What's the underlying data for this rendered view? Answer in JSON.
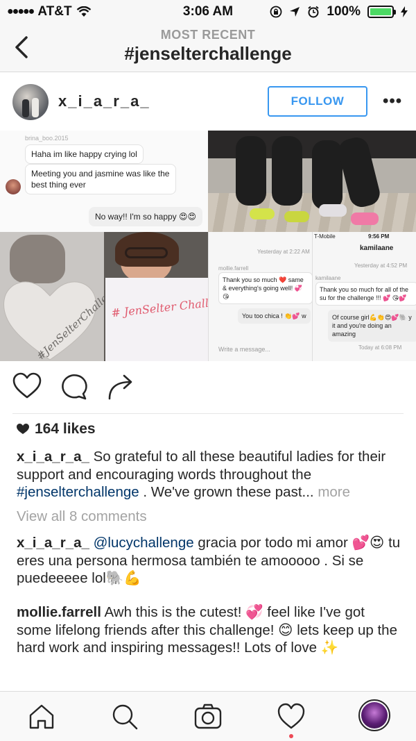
{
  "status_bar": {
    "carrier": "AT&T",
    "time": "3:06 AM",
    "battery": "100%"
  },
  "header": {
    "subtitle": "MOST RECENT",
    "title": "#jenselterchallenge"
  },
  "post": {
    "username": "x_i_a_r_a_",
    "follow_label": "FOLLOW",
    "more_label": "•••",
    "image": {
      "chat1": {
        "sender": "brina_boo.2015",
        "msg1": "Haha im like happy crying lol",
        "msg2": "Meeting you and jasmine was like the best thing ever",
        "msg3": "No way!! I'm so happy 😍😍"
      },
      "heart_text": "#JenSelterChallenge #Selfie?",
      "paper_text": "# JenSelter Challenge",
      "chat2": {
        "time": "Yesterday at 2:22 AM",
        "sender": "mollie.farrell",
        "msg1": "Thank you so much ❤️ same & everything's going well! 💞😘",
        "msg2": "You too chica ! 👏💕 w",
        "input": "Write a message..."
      },
      "chat3": {
        "carrier": "T-Mobile",
        "time": "9:56 PM",
        "title": "kamilaane",
        "stamp": "Yesterday at 4:52 PM",
        "sender": "kamilaane",
        "msg1": "Thank you so much for all of the su for the challenge !!! 💕 😘💕",
        "msg2": "Of course girl💪👏😍💕🐘 y it and you're doing an amazing",
        "stamp2": "Today at 6:08 PM"
      }
    },
    "likes": "164 likes",
    "caption": {
      "username": "x_i_a_r_a_",
      "text": "So grateful to all these beautiful ladies for their support and encouraging words throughout the",
      "hashtag": "#jenselterchallenge",
      "text2": ". We've grown  these past...",
      "more": "more"
    },
    "view_all": "View all 8 comments",
    "comments": [
      {
        "username": "x_i_a_r_a_",
        "mention": "@lucychallenge",
        "text": "gracia por todo mi amor 💕😍 tu eres una persona hermosa también te amooooo . Si se puedeeeee lol🐘💪"
      },
      {
        "username": "mollie.farrell",
        "text": "Awh this is the cutest! 💞 feel like I've got some lifelong friends after this challenge! 😊 lets keep up the hard work and inspiring messages!! Lots of love ✨"
      }
    ]
  },
  "colors": {
    "accent": "#3897f0",
    "hashtag": "#003569",
    "notification_dot": "#ed4956",
    "battery": "#4cd964"
  },
  "tab_bar": {
    "icons": [
      "home-icon",
      "search-icon",
      "camera-icon",
      "heart-icon",
      "profile-avatar"
    ]
  }
}
